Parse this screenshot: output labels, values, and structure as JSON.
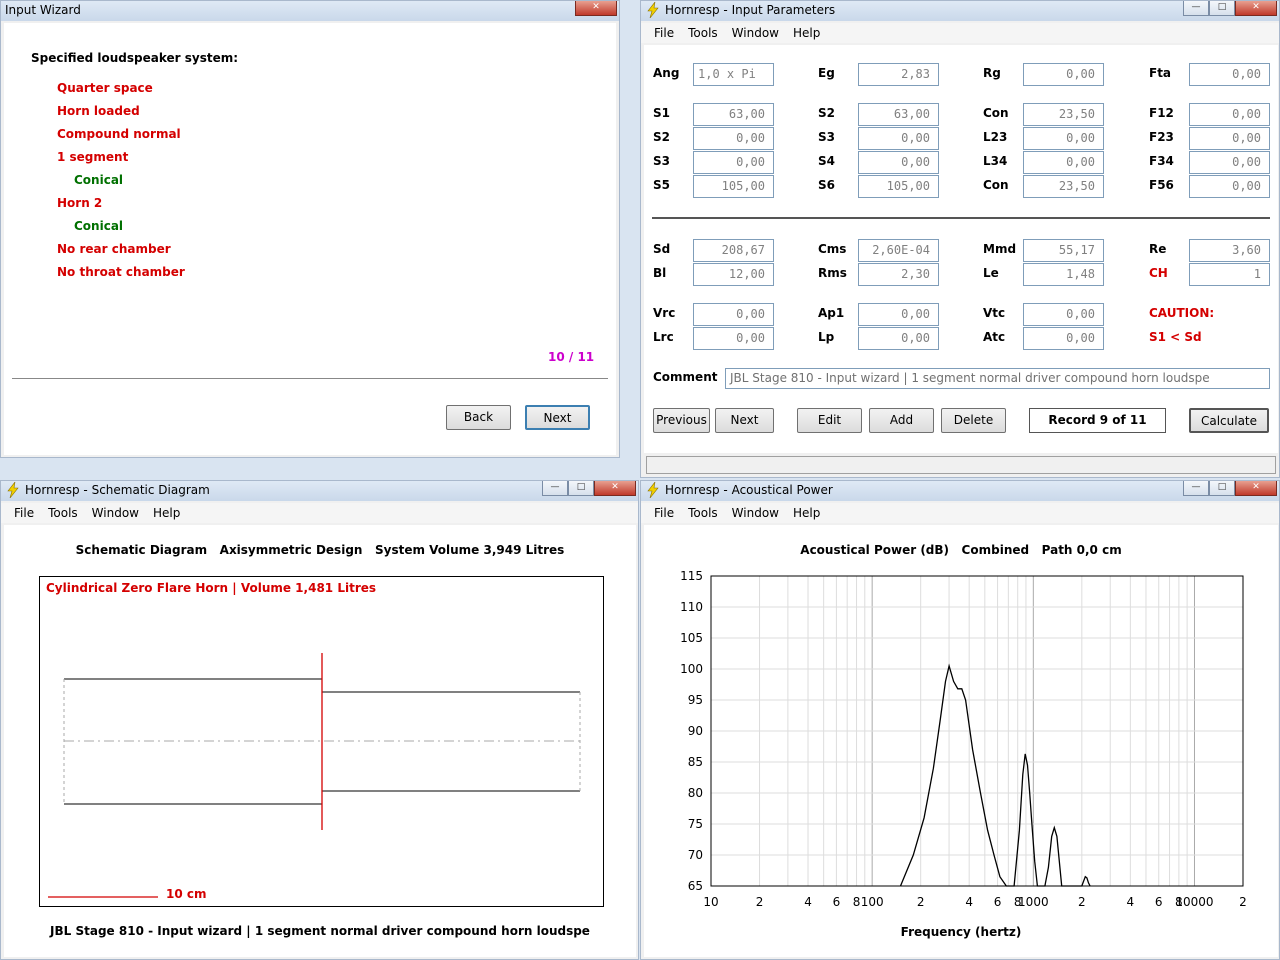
{
  "wizard": {
    "title": "Input Wizard",
    "heading": "Specified loudspeaker system:",
    "items": [
      {
        "text": "Quarter space",
        "color": "red",
        "indent": false
      },
      {
        "text": "Horn loaded",
        "color": "red",
        "indent": false
      },
      {
        "text": "Compound normal",
        "color": "red",
        "indent": false
      },
      {
        "text": "1 segment",
        "color": "red",
        "indent": false
      },
      {
        "text": "Conical",
        "color": "green",
        "indent": true
      },
      {
        "text": "Horn 2",
        "color": "red",
        "indent": false
      },
      {
        "text": "Conical",
        "color": "green",
        "indent": true
      },
      {
        "text": "No rear chamber",
        "color": "red",
        "indent": false
      },
      {
        "text": "No throat chamber",
        "color": "red",
        "indent": false
      }
    ],
    "page": "10 / 11",
    "back_label": "Back",
    "next_label": "Next"
  },
  "menu": [
    "File",
    "Tools",
    "Window",
    "Help"
  ],
  "params": {
    "title": "Hornresp - Input Parameters",
    "fields": [
      {
        "label": "Ang",
        "value": "1,0 x Pi",
        "red": false
      },
      {
        "label": "Eg",
        "value": "2,83",
        "red": false
      },
      {
        "label": "Rg",
        "value": "0,00",
        "red": false
      },
      {
        "label": "Fta",
        "value": "0,00",
        "red": false
      },
      {
        "label": "S1",
        "value": "63,00",
        "red": false
      },
      {
        "label": "S2",
        "value": "63,00",
        "red": false
      },
      {
        "label": "Con",
        "value": "23,50",
        "red": false
      },
      {
        "label": "F12",
        "value": "0,00",
        "red": false
      },
      {
        "label": "S2",
        "value": "0,00",
        "red": false
      },
      {
        "label": "S3",
        "value": "0,00",
        "red": false
      },
      {
        "label": "L23",
        "value": "0,00",
        "red": false
      },
      {
        "label": "F23",
        "value": "0,00",
        "red": false
      },
      {
        "label": "S3",
        "value": "0,00",
        "red": false
      },
      {
        "label": "S4",
        "value": "0,00",
        "red": false
      },
      {
        "label": "L34",
        "value": "0,00",
        "red": false
      },
      {
        "label": "F34",
        "value": "0,00",
        "red": false
      },
      {
        "label": "S5",
        "value": "105,00",
        "red": false
      },
      {
        "label": "S6",
        "value": "105,00",
        "red": false
      },
      {
        "label": "Con",
        "value": "23,50",
        "red": false
      },
      {
        "label": "F56",
        "value": "0,00",
        "red": false
      },
      {
        "label": "Sd",
        "value": "208,67",
        "red": false
      },
      {
        "label": "Cms",
        "value": "2,60E-04",
        "red": false
      },
      {
        "label": "Mmd",
        "value": "55,17",
        "red": false
      },
      {
        "label": "Re",
        "value": "3,60",
        "red": false
      },
      {
        "label": "Bl",
        "value": "12,00",
        "red": false
      },
      {
        "label": "Rms",
        "value": "2,30",
        "red": false
      },
      {
        "label": "Le",
        "value": "1,48",
        "red": false
      },
      {
        "label": "CH",
        "value": "1",
        "red": true
      },
      {
        "label": "Vrc",
        "value": "0,00",
        "red": false
      },
      {
        "label": "Ap1",
        "value": "0,00",
        "red": false
      },
      {
        "label": "Vtc",
        "value": "0,00",
        "red": false
      },
      {
        "label": "Lrc",
        "value": "0,00",
        "red": false
      },
      {
        "label": "Lp",
        "value": "0,00",
        "red": false
      },
      {
        "label": "Atc",
        "value": "0,00",
        "red": false
      }
    ],
    "caution1": "CAUTION:",
    "caution2": "S1 < Sd",
    "comment_label": "Comment",
    "comment_value": "JBL Stage 810 - Input wizard | 1 segment normal driver compound horn loudspe",
    "buttons": [
      "Previous",
      "Next",
      "Edit",
      "Add",
      "Delete"
    ],
    "record": "Record 9 of 11",
    "calculate": "Calculate"
  },
  "schematic": {
    "title": "Hornresp - Schematic Diagram",
    "header": "Schematic Diagram   Axisymmetric Design   System Volume 3,949 Litres",
    "box_title": "Cylindrical Zero Flare Horn | Volume 1,481 Litres",
    "scale": "10 cm",
    "footer": "JBL Stage 810 - Input wizard | 1 segment normal driver compound horn loudspe"
  },
  "acoustic": {
    "title": "Hornresp - Acoustical Power",
    "header": "Acoustical Power (dB)   Combined   Path 0,0 cm",
    "xlabel": "Frequency (hertz)"
  },
  "chart_data": {
    "type": "line",
    "title": "Acoustical Power (dB)   Combined   Path 0,0 cm",
    "xlabel": "Frequency (hertz)",
    "ylabel": "",
    "xscale": "log",
    "xlim": [
      10,
      20000
    ],
    "ylim": [
      65,
      115
    ],
    "yticks": [
      65,
      70,
      75,
      80,
      85,
      90,
      95,
      100,
      105,
      110,
      115
    ],
    "xtick_labels": [
      "10",
      "2",
      "4",
      "6",
      "8",
      "100",
      "2",
      "4",
      "6",
      "8",
      "1000",
      "2",
      "4",
      "6",
      "8",
      "10000",
      "2"
    ],
    "grid": true,
    "series": [
      {
        "x": [
          150,
          180,
          210,
          240,
          265,
          285,
          300,
          320,
          340,
          360,
          380,
          420,
          470,
          520,
          570,
          620,
          680,
          760,
          820,
          860,
          890,
          920,
          950,
          980,
          1020,
          1060,
          1110,
          1180,
          1240,
          1300,
          1350,
          1400,
          1450,
          1500,
          1550,
          1600,
          1650,
          1700,
          1750,
          2000,
          2100,
          2150,
          2200,
          2250
        ],
        "values": [
          65,
          70,
          76,
          84,
          92,
          98,
          100.5,
          98,
          96.8,
          96.8,
          95,
          87,
          80,
          74,
          70,
          66.5,
          65,
          65,
          74,
          83,
          86.3,
          84.5,
          80,
          75,
          69,
          65,
          65,
          65,
          68,
          73,
          74.4,
          73,
          69,
          65,
          65,
          65,
          65,
          65,
          65,
          65,
          66.5,
          66.3,
          65.5,
          65
        ]
      }
    ]
  }
}
